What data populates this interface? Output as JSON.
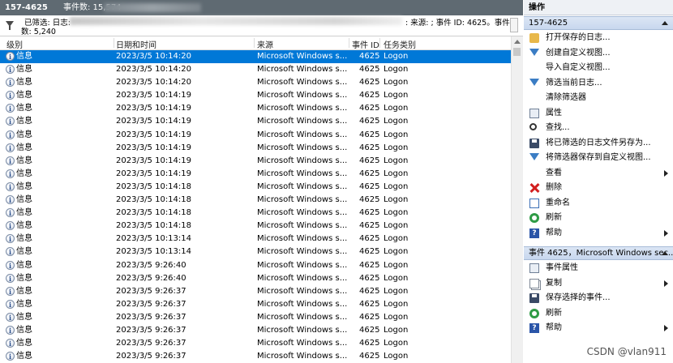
{
  "window": {
    "title_id": "157-4625",
    "event_count": "事件数: 15,574"
  },
  "filter": {
    "line1": "已筛选: 日志:",
    "line2": "数: 5,240",
    "right": ": 来源: ; 事件 ID: 4625。事件"
  },
  "columns": {
    "level": "级别",
    "datetime": "日期和时间",
    "source": "来源",
    "event_id": "事件 ID",
    "category": "任务类别"
  },
  "rows": [
    {
      "level": "信息",
      "datetime": "2023/3/5 10:14:20",
      "source": "Microsoft Windows s...",
      "id": "4625",
      "category": "Logon"
    },
    {
      "level": "信息",
      "datetime": "2023/3/5 10:14:20",
      "source": "Microsoft Windows s...",
      "id": "4625",
      "category": "Logon"
    },
    {
      "level": "信息",
      "datetime": "2023/3/5 10:14:20",
      "source": "Microsoft Windows s...",
      "id": "4625",
      "category": "Logon"
    },
    {
      "level": "信息",
      "datetime": "2023/3/5 10:14:19",
      "source": "Microsoft Windows s...",
      "id": "4625",
      "category": "Logon"
    },
    {
      "level": "信息",
      "datetime": "2023/3/5 10:14:19",
      "source": "Microsoft Windows s...",
      "id": "4625",
      "category": "Logon"
    },
    {
      "level": "信息",
      "datetime": "2023/3/5 10:14:19",
      "source": "Microsoft Windows s...",
      "id": "4625",
      "category": "Logon"
    },
    {
      "level": "信息",
      "datetime": "2023/3/5 10:14:19",
      "source": "Microsoft Windows s...",
      "id": "4625",
      "category": "Logon"
    },
    {
      "level": "信息",
      "datetime": "2023/3/5 10:14:19",
      "source": "Microsoft Windows s...",
      "id": "4625",
      "category": "Logon"
    },
    {
      "level": "信息",
      "datetime": "2023/3/5 10:14:19",
      "source": "Microsoft Windows s...",
      "id": "4625",
      "category": "Logon"
    },
    {
      "level": "信息",
      "datetime": "2023/3/5 10:14:19",
      "source": "Microsoft Windows s...",
      "id": "4625",
      "category": "Logon"
    },
    {
      "level": "信息",
      "datetime": "2023/3/5 10:14:18",
      "source": "Microsoft Windows s...",
      "id": "4625",
      "category": "Logon"
    },
    {
      "level": "信息",
      "datetime": "2023/3/5 10:14:18",
      "source": "Microsoft Windows s...",
      "id": "4625",
      "category": "Logon"
    },
    {
      "level": "信息",
      "datetime": "2023/3/5 10:14:18",
      "source": "Microsoft Windows s...",
      "id": "4625",
      "category": "Logon"
    },
    {
      "level": "信息",
      "datetime": "2023/3/5 10:14:18",
      "source": "Microsoft Windows s...",
      "id": "4625",
      "category": "Logon"
    },
    {
      "level": "信息",
      "datetime": "2023/3/5 10:13:14",
      "source": "Microsoft Windows s...",
      "id": "4625",
      "category": "Logon"
    },
    {
      "level": "信息",
      "datetime": "2023/3/5 10:13:14",
      "source": "Microsoft Windows s...",
      "id": "4625",
      "category": "Logon"
    },
    {
      "level": "信息",
      "datetime": "2023/3/5 9:26:40",
      "source": "Microsoft Windows s...",
      "id": "4625",
      "category": "Logon"
    },
    {
      "level": "信息",
      "datetime": "2023/3/5 9:26:40",
      "source": "Microsoft Windows s...",
      "id": "4625",
      "category": "Logon"
    },
    {
      "level": "信息",
      "datetime": "2023/3/5 9:26:37",
      "source": "Microsoft Windows s...",
      "id": "4625",
      "category": "Logon"
    },
    {
      "level": "信息",
      "datetime": "2023/3/5 9:26:37",
      "source": "Microsoft Windows s...",
      "id": "4625",
      "category": "Logon"
    },
    {
      "level": "信息",
      "datetime": "2023/3/5 9:26:37",
      "source": "Microsoft Windows s...",
      "id": "4625",
      "category": "Logon"
    },
    {
      "level": "信息",
      "datetime": "2023/3/5 9:26:37",
      "source": "Microsoft Windows s...",
      "id": "4625",
      "category": "Logon"
    },
    {
      "level": "信息",
      "datetime": "2023/3/5 9:26:37",
      "source": "Microsoft Windows s...",
      "id": "4625",
      "category": "Logon"
    },
    {
      "level": "信息",
      "datetime": "2023/3/5 9:26:37",
      "source": "Microsoft Windows s...",
      "id": "4625",
      "category": "Logon"
    }
  ],
  "actions": {
    "title": "操作",
    "section1": "157-4625",
    "items1": [
      {
        "label": "打开保存的日志...",
        "icon": "folder-open-icon"
      },
      {
        "label": "创建自定义视图...",
        "icon": "filter-icon"
      },
      {
        "label": "导入自定义视图...",
        "icon": ""
      },
      {
        "label": "筛选当前日志...",
        "icon": "filter-icon"
      },
      {
        "label": "清除筛选器",
        "icon": ""
      },
      {
        "label": "属性",
        "icon": "properties-icon"
      },
      {
        "label": "查找...",
        "icon": "binoculars-icon"
      },
      {
        "label": "将已筛选的日志文件另存为...",
        "icon": "save-icon"
      },
      {
        "label": "将筛选器保存到自定义视图...",
        "icon": "filter-save-icon"
      },
      {
        "label": "查看",
        "icon": "",
        "submenu": true
      },
      {
        "label": "删除",
        "icon": "delete-icon"
      },
      {
        "label": "重命名",
        "icon": "rename-icon"
      },
      {
        "label": "刷新",
        "icon": "refresh-icon"
      },
      {
        "label": "帮助",
        "icon": "help-icon",
        "submenu": true
      }
    ],
    "section2": "事件 4625，Microsoft Windows sec...",
    "items2": [
      {
        "label": "事件属性",
        "icon": "properties-icon"
      },
      {
        "label": "复制",
        "icon": "copy-icon",
        "submenu": true
      },
      {
        "label": "保存选择的事件...",
        "icon": "save-icon"
      },
      {
        "label": "刷新",
        "icon": "refresh-icon"
      },
      {
        "label": "帮助",
        "icon": "help-icon",
        "submenu": true
      }
    ]
  },
  "watermark": "CSDN @vlan911",
  "colors": {
    "selection": "#0078d7",
    "section_header": "#c7d7ee",
    "title_bar": "#5f6a72"
  }
}
